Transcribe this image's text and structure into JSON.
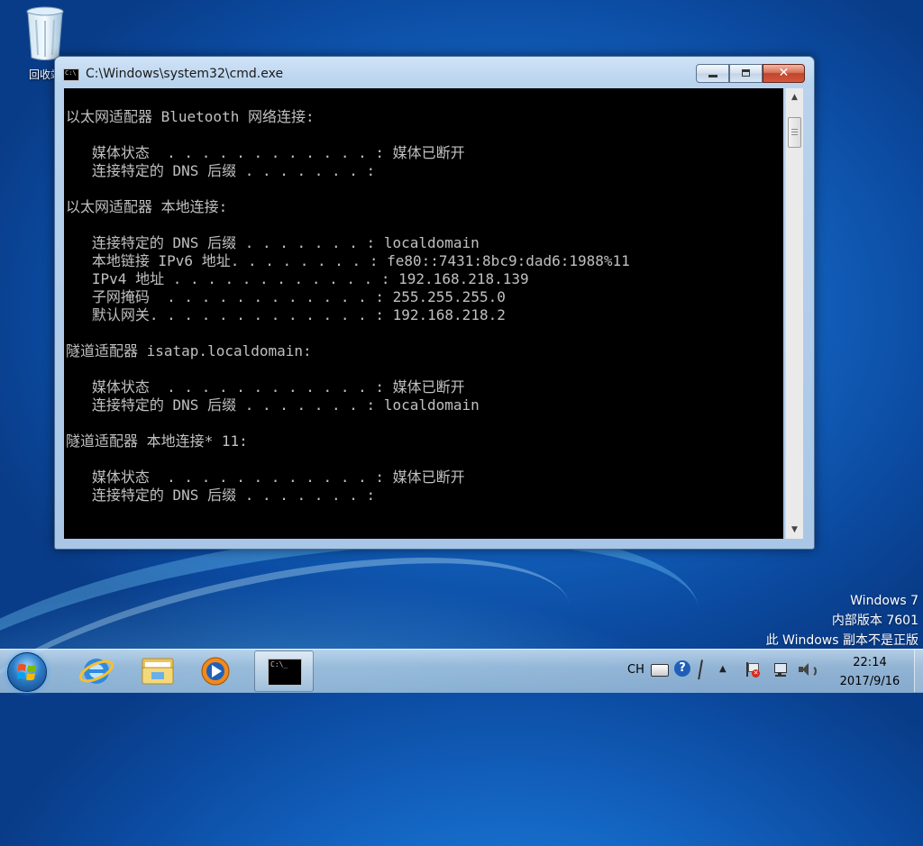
{
  "desktop": {
    "icons": [
      {
        "label": "回收站",
        "icon": "recycle-bin-icon"
      }
    ],
    "watermark": {
      "line1": "Windows 7",
      "line2": "内部版本 7601",
      "line3": "此 Windows 副本不是正版"
    }
  },
  "window": {
    "title": "C:\\Windows\\system32\\cmd.exe",
    "icon_text": "C:\\",
    "close_glyph": "✕",
    "console_lines": [
      "",
      "以太网适配器 Bluetooth 网络连接:",
      "",
      "   媒体状态  . . . . . . . . . . . . : 媒体已断开",
      "   连接特定的 DNS 后缀 . . . . . . . :",
      "",
      "以太网适配器 本地连接:",
      "",
      "   连接特定的 DNS 后缀 . . . . . . . : localdomain",
      "   本地链接 IPv6 地址. . . . . . . . : fe80::7431:8bc9:dad6:1988%11",
      "   IPv4 地址 . . . . . . . . . . . . : 192.168.218.139",
      "   子网掩码  . . . . . . . . . . . . : 255.255.255.0",
      "   默认网关. . . . . . . . . . . . . : 192.168.218.2",
      "",
      "隧道适配器 isatap.localdomain:",
      "",
      "   媒体状态  . . . . . . . . . . . . : 媒体已断开",
      "   连接特定的 DNS 后缀 . . . . . . . : localdomain",
      "",
      "隧道适配器 本地连接* 11:",
      "",
      "   媒体状态  . . . . . . . . . . . . : 媒体已断开",
      "   连接特定的 DNS 后缀 . . . . . . . :"
    ],
    "scroll": {
      "up_glyph": "▲",
      "down_glyph": "▼"
    }
  },
  "taskbar": {
    "items": [
      {
        "name": "ie",
        "icon": "internet-explorer-icon"
      },
      {
        "name": "explorer",
        "icon": "folder-icon"
      },
      {
        "name": "media-player",
        "icon": "media-player-icon"
      },
      {
        "name": "cmd",
        "icon": "command-prompt-icon",
        "active": true,
        "icon_text": "C:\\_"
      }
    ],
    "tray": {
      "language": "CH",
      "help_glyph": "?",
      "expand_glyph": "▲",
      "icons": [
        "keyboard-icon",
        "help-icon",
        "pen-icon",
        "show-hidden-icons-icon",
        "action-center-flag-icon",
        "network-icon",
        "volume-icon"
      ]
    },
    "clock": {
      "time": "22:14",
      "date": "2017/9/16"
    }
  }
}
